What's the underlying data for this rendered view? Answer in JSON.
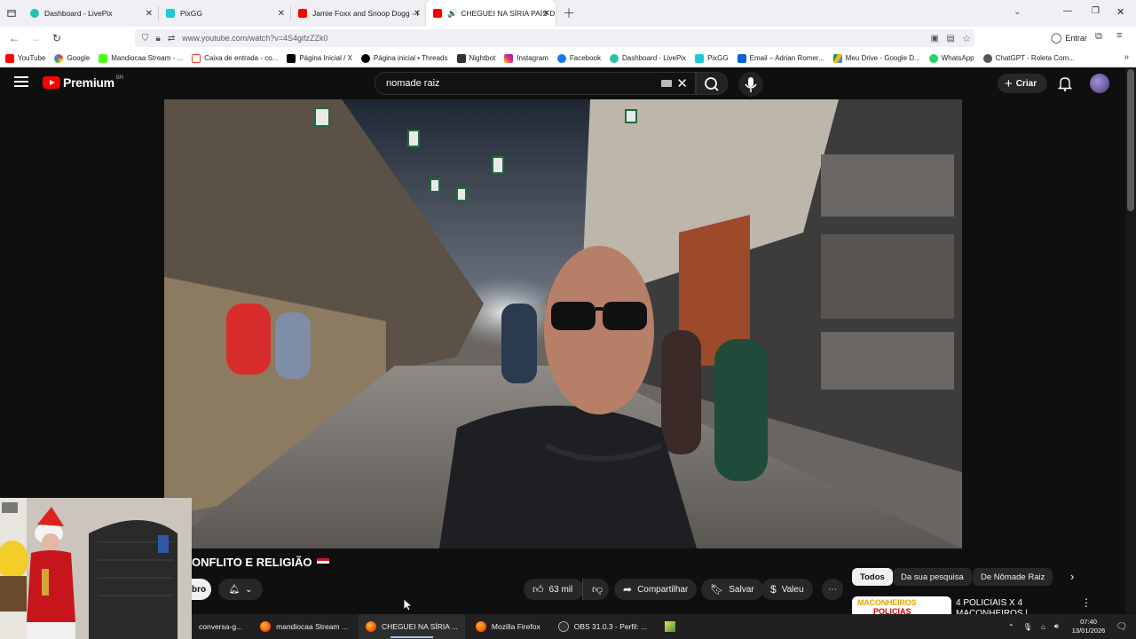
{
  "browser": {
    "tabs": [
      {
        "label": "Dashboard - LivePix",
        "active": false
      },
      {
        "label": "PixGG",
        "active": false
      },
      {
        "label": "Jamie Foxx and Snoop Dogg - I",
        "active": false
      },
      {
        "label": "CHEGUEI NA SÍRIA PAÍS DE",
        "active": true
      }
    ],
    "url": "www.youtube.com/watch?v=4S4gifzZZk0",
    "signin_label": "Entrar",
    "bookmarks": [
      "YouTube",
      "Google",
      "Mandiocaa Stream - ...",
      "Caixa de entrada - co...",
      "Página Inicial / X",
      "Página inicial • Threads",
      "Nightbot",
      "Instagram",
      "Facebook",
      "Dashboard - LivePix",
      "PixGG",
      "Email – Adrian Romer...",
      "Meu Drive - Google D...",
      "WhatsApp",
      "ChatGPT - Roleta Com..."
    ]
  },
  "youtube": {
    "logo_text": "Premium",
    "region": "BR",
    "search_value": "nomade raiz",
    "create_label": "Criar",
    "video_title": "ONFLITO E RELIGIÃO",
    "subscribe_label": "bro",
    "likes": "63 mil",
    "share_label": "Compartilhar",
    "save_label": "Salvar",
    "thanks_label": "Valeu",
    "chips": [
      "Todos",
      "Da sua pesquisa",
      "De Nômade Raiz"
    ],
    "related": {
      "thumb_line1": "MACONHEIROS",
      "thumb_line2": "POLICIAS",
      "title": "4 POLICIAIS X 4 MACONHEIROS |"
    }
  },
  "taskbar": {
    "items": [
      "conversa-g...",
      "mandiocaa Stream ...",
      "CHEGUEI NA SÍRIA ...",
      "Mozilla Firefox",
      "OBS 31.0.3 - Perfil: ..."
    ],
    "time": "07:40",
    "date": "13/01/2026"
  }
}
